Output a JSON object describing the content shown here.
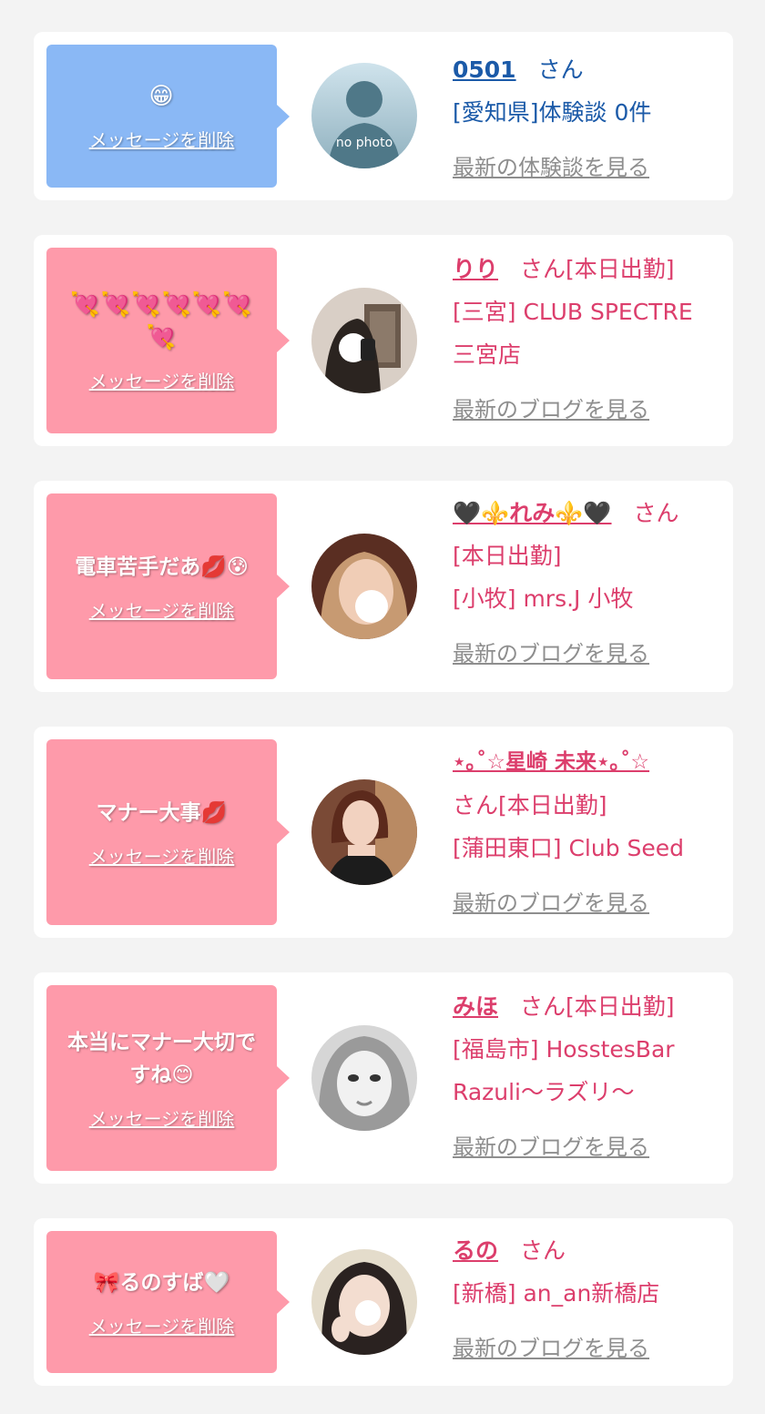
{
  "colors": {
    "page_background": "#f3f3f3",
    "bubble_blue": "#8ab8f5",
    "bubble_pink": "#fe9aaa",
    "text_blue": "#1b5aa8",
    "text_pink": "#dc3e6c",
    "link_gray": "#8e8e8e"
  },
  "delete_label": "メッセージを削除",
  "blog_label": "最新のブログを見る",
  "review_label": "最新の体験談を見る",
  "cards": [
    {
      "message": "😁",
      "name": "0501",
      "suffix": "さん",
      "line1": "[愛知県]体験談 0件",
      "line2": "",
      "link": "最新の体験談を見る",
      "avatar_text": "no photo"
    },
    {
      "message": "💘💘💘💘💘💘💘",
      "name": "りり",
      "suffix": "さん[本日出勤]",
      "line1": "[三宮] CLUB SPECTRE",
      "line2": "三宮店",
      "link": "最新のブログを見る"
    },
    {
      "message": "電車苦手だあ💋😰",
      "name": "🖤⚜️れみ⚜️🖤",
      "suffix": "さん",
      "line1": "[本日出勤]",
      "line2": "[小牧] mrs.J 小牧",
      "link": "最新のブログを見る"
    },
    {
      "message": "マナー大事💋",
      "name": "⋆｡˚☆星崎 未来⋆｡˚☆",
      "suffix": "さん[本日出勤]",
      "line1": "[蒲田東口] Club Seed",
      "line2": "",
      "link": "最新のブログを見る"
    },
    {
      "message": "本当にマナー大切ですね😊",
      "name": "みほ",
      "suffix": "さん[本日出勤]",
      "line1": "[福島市] HosstesBar",
      "line2": "Razuli〜ラズリ〜",
      "link": "最新のブログを見る"
    },
    {
      "message": "🎀るのすば🤍",
      "name": "るの",
      "suffix": "さん",
      "line1": "[新橋] an_an新橋店",
      "line2": "",
      "link": "最新のブログを見る"
    }
  ]
}
